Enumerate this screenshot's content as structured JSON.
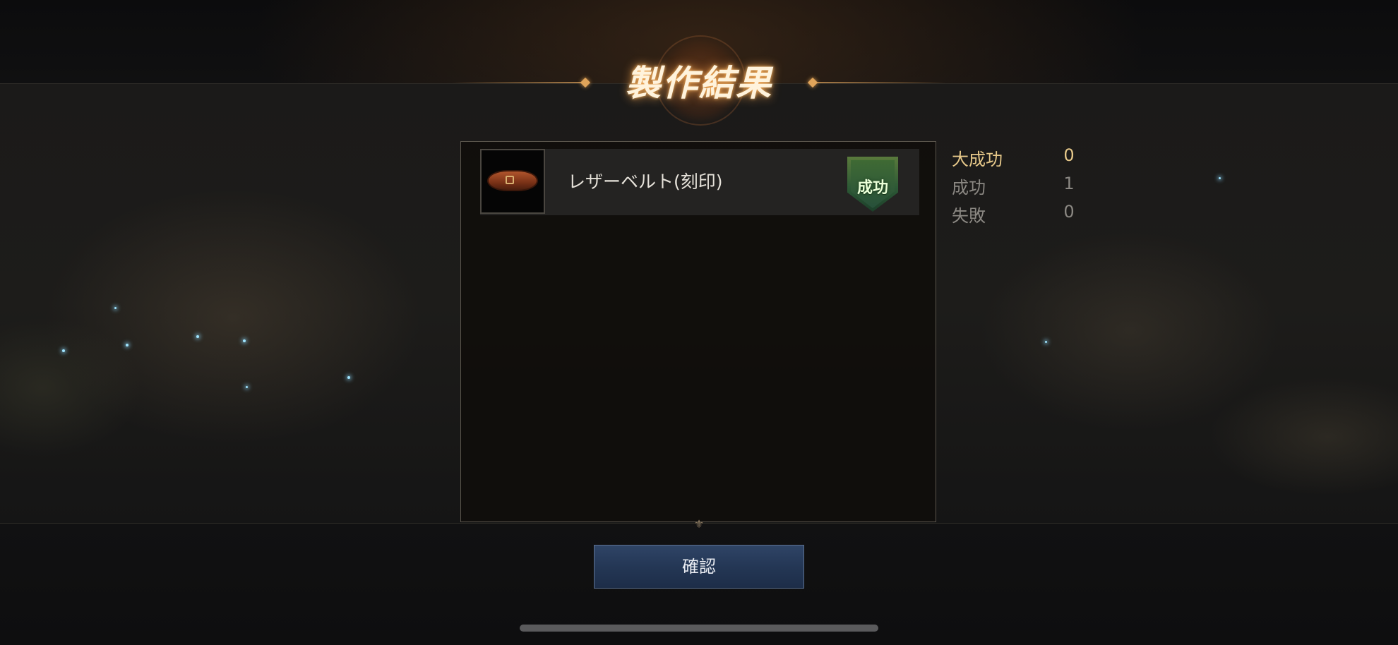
{
  "header": {
    "title": "製作結果"
  },
  "results": {
    "items": [
      {
        "name": "レザーベルト(刻印)",
        "icon": "leather-belt-icon",
        "badge": "成功",
        "badge_color": "#2e5a36"
      }
    ]
  },
  "stats": {
    "great_success": {
      "label": "大成功",
      "value": "0",
      "color": "#e7c98a"
    },
    "success": {
      "label": "成功",
      "value": "1",
      "color": "#8b8883"
    },
    "failure": {
      "label": "失敗",
      "value": "0",
      "color": "#8b8883"
    }
  },
  "actions": {
    "confirm_label": "確認"
  }
}
